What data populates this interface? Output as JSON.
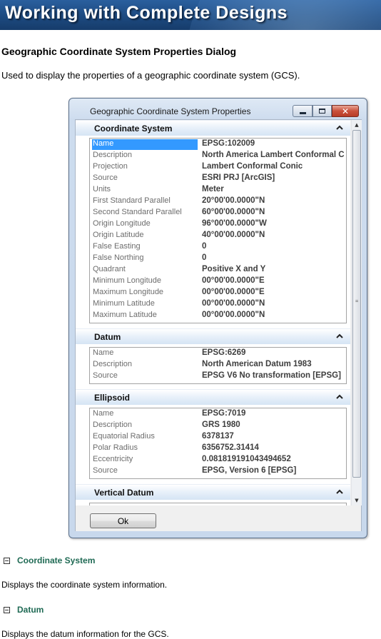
{
  "banner": {
    "title": "Working with Complete Designs"
  },
  "page": {
    "heading": "Geographic Coordinate System Properties Dialog",
    "description": "Used to display the properties of a geographic coordinate system (GCS).",
    "sections": [
      {
        "label": "Coordinate System",
        "text": "Displays the coordinate system information."
      },
      {
        "label": "Datum",
        "text": "Displays the datum information for the GCS."
      }
    ]
  },
  "dialog": {
    "title": "Geographic Coordinate System Properties",
    "ok_label": "Ok",
    "coordinate_system": {
      "title": "Coordinate System",
      "rows": [
        {
          "name": "Name",
          "value": "EPSG:102009"
        },
        {
          "name": "Description",
          "value": "North America Lambert Conformal C"
        },
        {
          "name": "Projection",
          "value": "Lambert Conformal Conic"
        },
        {
          "name": "Source",
          "value": "ESRI PRJ [ArcGIS]"
        },
        {
          "name": "Units",
          "value": "Meter"
        },
        {
          "name": "First Standard Parallel",
          "value": "20°00'00.0000\"N"
        },
        {
          "name": "Second Standard Parallel",
          "value": "60°00'00.0000\"N"
        },
        {
          "name": "Origin Longitude",
          "value": "96°00'00.0000\"W"
        },
        {
          "name": "Origin Latitude",
          "value": "40°00'00.0000\"N"
        },
        {
          "name": "False Easting",
          "value": "0"
        },
        {
          "name": "False Northing",
          "value": "0"
        },
        {
          "name": "Quadrant",
          "value": "Positive X and Y"
        },
        {
          "name": "Minimum Longitude",
          "value": "00°00'00.0000\"E"
        },
        {
          "name": "Maximum Longitude",
          "value": "00°00'00.0000\"E"
        },
        {
          "name": "Minimum Latitude",
          "value": "00°00'00.0000\"N"
        },
        {
          "name": "Maximum Latitude",
          "value": "00°00'00.0000\"N"
        }
      ]
    },
    "datum": {
      "title": "Datum",
      "rows": [
        {
          "name": "Name",
          "value": "EPSG:6269"
        },
        {
          "name": "Description",
          "value": "North American Datum 1983"
        },
        {
          "name": "Source",
          "value": "EPSG V6 No transformation [EPSG]"
        }
      ]
    },
    "ellipsoid": {
      "title": "Ellipsoid",
      "rows": [
        {
          "name": "Name",
          "value": "EPSG:7019"
        },
        {
          "name": "Description",
          "value": "GRS 1980"
        },
        {
          "name": "Equatorial Radius",
          "value": "6378137"
        },
        {
          "name": "Polar Radius",
          "value": "6356752.31414"
        },
        {
          "name": "Eccentricity",
          "value": "0.081819191043494652"
        },
        {
          "name": "Source",
          "value": "EPSG, Version 6 [EPSG]"
        }
      ]
    },
    "vertical_datum": {
      "title": "Vertical Datum"
    }
  }
}
